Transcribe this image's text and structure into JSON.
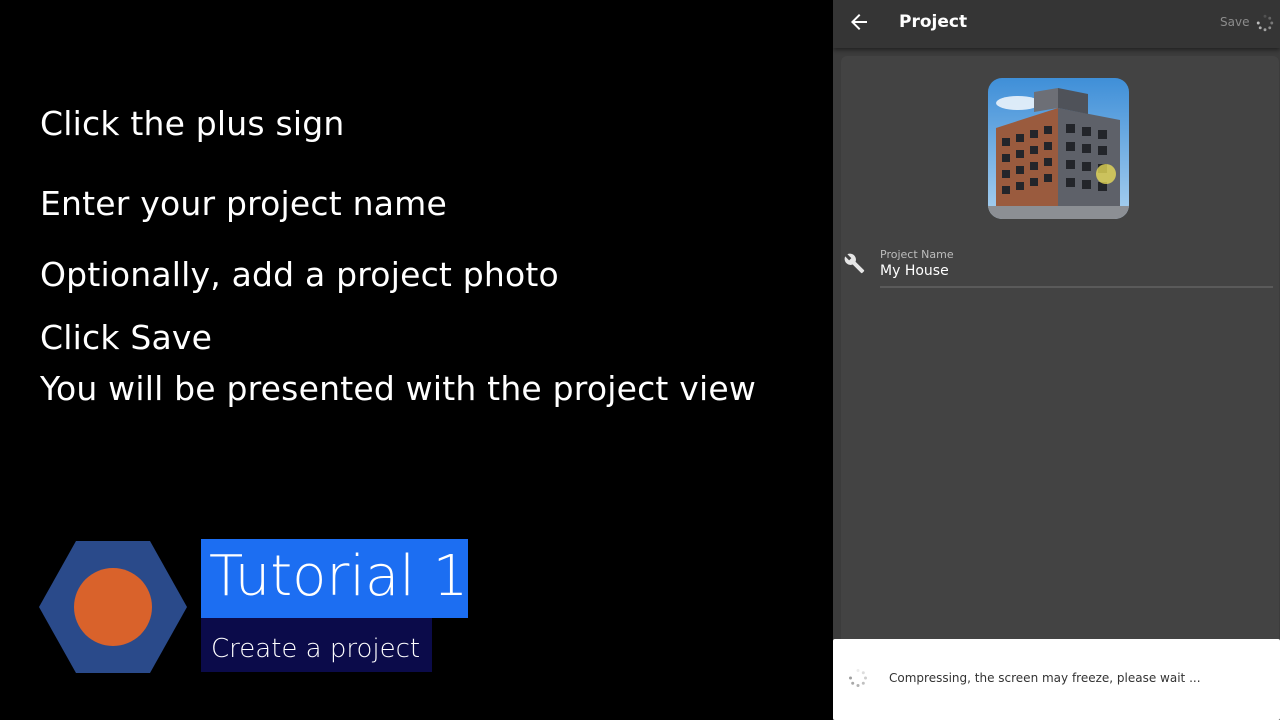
{
  "tutorial": {
    "steps": [
      "Click the plus sign",
      "Enter your project name",
      "Optionally, add a project photo",
      "Click Save",
      "You will be presented with the project view"
    ],
    "title": "Tutorial 1",
    "subtitle": "Create a project"
  },
  "app": {
    "title": "Project",
    "save_label": "Save",
    "project_name": {
      "label": "Project Name",
      "value": "My House"
    },
    "toast": {
      "message": "Compressing, the screen may freeze, please wait ..."
    }
  },
  "colors": {
    "title_badge": "#1c6ef2",
    "subtitle_badge": "#0b0b4a",
    "logo_hex": "#2a4a8a",
    "logo_circle": "#d9622b",
    "app_bg": "#3c3c3c"
  },
  "icons": {
    "back": "arrow-left-icon",
    "save_spinner": "spinner-icon",
    "project_field": "tools-icon",
    "toast_spinner": "spinner-icon"
  }
}
